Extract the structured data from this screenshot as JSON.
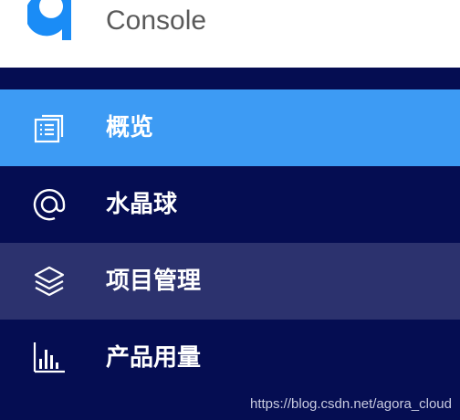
{
  "header": {
    "title": "Console"
  },
  "nav": {
    "items": [
      {
        "label": "概览",
        "icon": "overview-icon"
      },
      {
        "label": "水晶球",
        "icon": "at-sign-icon"
      },
      {
        "label": "项目管理",
        "icon": "layers-icon"
      },
      {
        "label": "产品用量",
        "icon": "bar-chart-icon"
      }
    ]
  },
  "watermark": "https://blog.csdn.net/agora_cloud",
  "colors": {
    "nav_background": "#050d52",
    "active": "#3d9bf4",
    "hover": "#2c326e",
    "logo": "#1a8cf6"
  }
}
